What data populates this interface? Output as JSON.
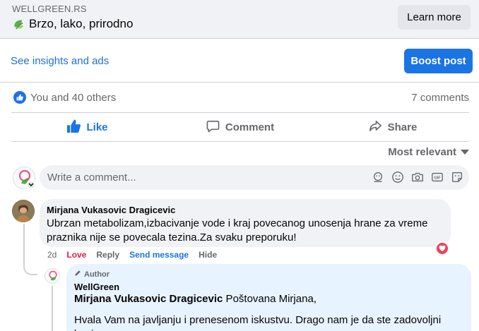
{
  "preview": {
    "domain": "WELLGREEN.RS",
    "title": "Brzo, lako, prirodno",
    "cta": "Learn more"
  },
  "insights": {
    "link": "See insights and ads",
    "boost": "Boost post"
  },
  "reactions": {
    "summary": "You and 40 others",
    "comments": "7 comments"
  },
  "actions": {
    "like": "Like",
    "comment": "Comment",
    "share": "Share"
  },
  "sort": {
    "label": "Most relevant"
  },
  "composer": {
    "placeholder": "Write a comment..."
  },
  "comment": {
    "author": "Mirjana Vukasovic Dragicevic",
    "text": "Ubrzan metabolizam,izbacivanje vode i kraj povecanog unosenja hrane za vreme praznika nije se povecala tezina.Za svaku preporuku!",
    "time": "2d",
    "love": "Love",
    "reply": "Reply",
    "send": "Send message",
    "hide": "Hide"
  },
  "reply": {
    "badge": "Author",
    "author": "WellGreen",
    "mention": "Mirjana Vukasovic Dragicevic",
    "greeting": " Poštovana Mirjana,",
    "text": "Hvala Vam na javljanju i prenesenom iskustvu. Drago nam je da ste zadovoljni kupi..."
  },
  "colors": {
    "accent": "#1b74e4",
    "love": "#e41e3f",
    "reply_bg": "#e7f3ff"
  }
}
